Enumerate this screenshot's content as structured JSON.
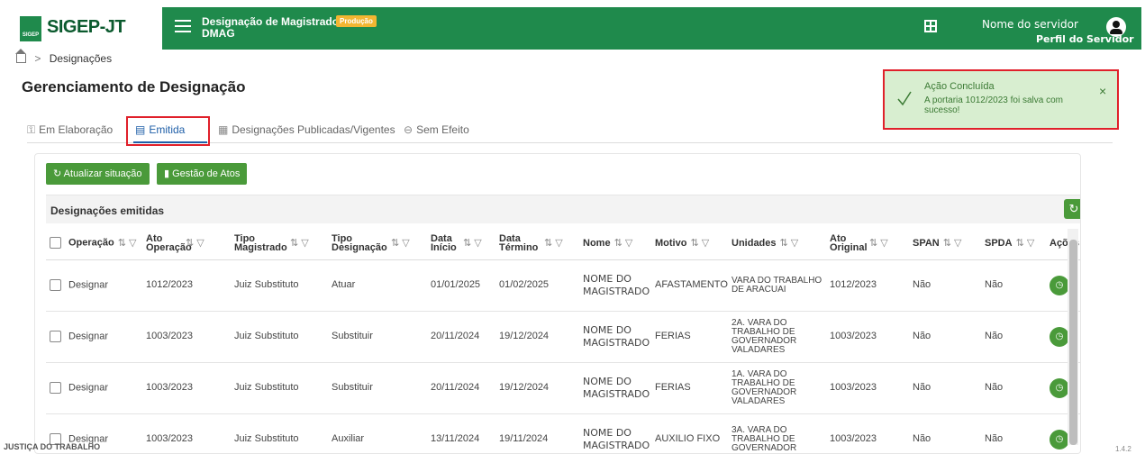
{
  "header": {
    "logo_mark": "SIGEP",
    "logo_text": "SIGEP-JT",
    "app_title_line1": "Designação de Magistrados",
    "app_title_line2": "DMAG",
    "env_badge": "Produção",
    "user_name": "Nome do servidor",
    "user_profile": "Perfil do Servidor",
    "brand_color": "#1f8a4c",
    "badge_color": "#f2b632"
  },
  "breadcrumb": {
    "current": "Designações"
  },
  "page": {
    "title": "Gerenciamento de Designação"
  },
  "tabs": [
    {
      "label": "Em Elaboração",
      "icon": "user-edit-icon"
    },
    {
      "label": "Emitida",
      "icon": "document-icon",
      "active": true
    },
    {
      "label": "Designações Publicadas/Vigentes",
      "icon": "calendar-icon"
    },
    {
      "label": "Sem Efeito",
      "icon": "minus-circle-icon"
    }
  ],
  "toolbar": {
    "update_label": "Atualizar situação",
    "acts_label": "Gestão de Atos",
    "button_color": "#4a9a3a"
  },
  "table": {
    "title": "Designações emitidas",
    "columns": [
      "Operação",
      "Ato Operação",
      "Tipo Magistrado",
      "Tipo Designação",
      "Data Início",
      "Data Término",
      "Nome",
      "Motivo",
      "Unidades",
      "Ato Original",
      "SPAN",
      "SPDA",
      "Ações"
    ],
    "rows": [
      {
        "operacao": "Designar",
        "ato": "1012/2023",
        "tipo_mag": "Juiz Substituto",
        "tipo_des": "Atuar",
        "inicio": "01/01/2025",
        "termino": "01/02/2025",
        "nome": "NOME DO MAGISTRADO",
        "motivo": "AFASTAMENTO",
        "unidades": "VARA DO TRABALHO DE ARACUAI",
        "ato_original": "1012/2023",
        "span": "Não",
        "spda": "Não"
      },
      {
        "operacao": "Designar",
        "ato": "1003/2023",
        "tipo_mag": "Juiz Substituto",
        "tipo_des": "Substituir",
        "inicio": "20/11/2024",
        "termino": "19/12/2024",
        "nome": "NOME DO MAGISTRADO",
        "motivo": "FERIAS",
        "unidades": "2A. VARA DO TRABALHO DE GOVERNADOR VALADARES",
        "ato_original": "1003/2023",
        "span": "Não",
        "spda": "Não"
      },
      {
        "operacao": "Designar",
        "ato": "1003/2023",
        "tipo_mag": "Juiz Substituto",
        "tipo_des": "Substituir",
        "inicio": "20/11/2024",
        "termino": "19/12/2024",
        "nome": "NOME DO MAGISTRADO",
        "motivo": "FERIAS",
        "unidades": "1A. VARA DO TRABALHO DE GOVERNADOR VALADARES",
        "ato_original": "1003/2023",
        "span": "Não",
        "spda": "Não"
      },
      {
        "operacao": "Designar",
        "ato": "1003/2023",
        "tipo_mag": "Juiz Substituto",
        "tipo_des": "Auxiliar",
        "inicio": "13/11/2024",
        "termino": "19/11/2024",
        "nome": "NOME DO MAGISTRADO",
        "motivo": "AUXILIO FIXO",
        "unidades": "3A. VARA DO TRABALHO DE GOVERNADOR",
        "ato_original": "1003/2023",
        "span": "Não",
        "spda": "Não"
      }
    ]
  },
  "toast": {
    "title": "Ação Concluída",
    "message": "A portaria 1012/2023 foi salva com sucesso!",
    "bg_color": "#d8eed0"
  },
  "footer": {
    "logo": "JUSTIÇA DO TRABALHO",
    "version": "1.4.2"
  }
}
